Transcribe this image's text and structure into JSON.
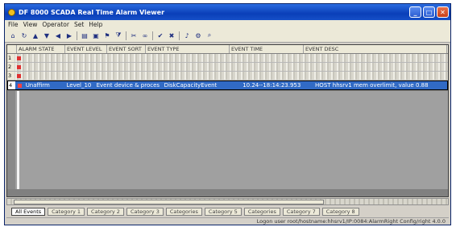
{
  "window": {
    "title": "DF 8000 SCADA Real Time Alarm Viewer",
    "min_icon": "minimize-icon",
    "max_icon": "maximize-icon",
    "close_icon": "close-icon"
  },
  "menu": [
    "File",
    "View",
    "Operator",
    "Set",
    "Help"
  ],
  "toolbar": {
    "icons": [
      "home-icon",
      "refresh-icon",
      "arrow-up-icon",
      "arrow-down-icon",
      "arrow-left-icon",
      "arrow-right-icon",
      "sep",
      "print-icon",
      "save-icon",
      "flag-icon",
      "filter-icon",
      "sep",
      "cut-icon",
      "link-icon",
      "sep",
      "ack-icon",
      "clear-icon",
      "sep",
      "bell-icon",
      "settings-icon",
      "find-icon"
    ]
  },
  "table": {
    "headers": [
      "ALARM STATE",
      "EVENT LEVEL",
      "EVENT SORT",
      "EVENT TYPE",
      "EVENT TIME",
      "EVENT DESC"
    ],
    "rows": [
      {
        "num": "1",
        "state": "",
        "level": "",
        "sort": "",
        "type": "",
        "time": "",
        "desc": ""
      },
      {
        "num": "2",
        "state": "",
        "level": "",
        "sort": "",
        "type": "",
        "time": "",
        "desc": ""
      },
      {
        "num": "3",
        "state": "",
        "level": "",
        "sort": "",
        "type": "",
        "time": "",
        "desc": ""
      }
    ],
    "selected_row": {
      "num": "4",
      "state": "Unaffirm",
      "level": "Level_10",
      "sort": "Event device & proces",
      "type": "DiskCapacityEvent",
      "time": "10.24--18:14:23.953",
      "desc": "HOST hhsrv1 mem overlimit, value 0.88"
    }
  },
  "categories": [
    "All Events",
    "Category 1",
    "Category 2",
    "Category 3",
    "Categories",
    "Category 5",
    "Categories",
    "Category 7",
    "Category 8"
  ],
  "status": {
    "text": "Logon user root/hostname:hhsrv1/IP:0084:AlarmRight Config/right 4.0.0"
  },
  "colors": {
    "selection": "#316ac5",
    "alarm_dot": "#e03030",
    "titlebar": "#0a3fb8"
  }
}
